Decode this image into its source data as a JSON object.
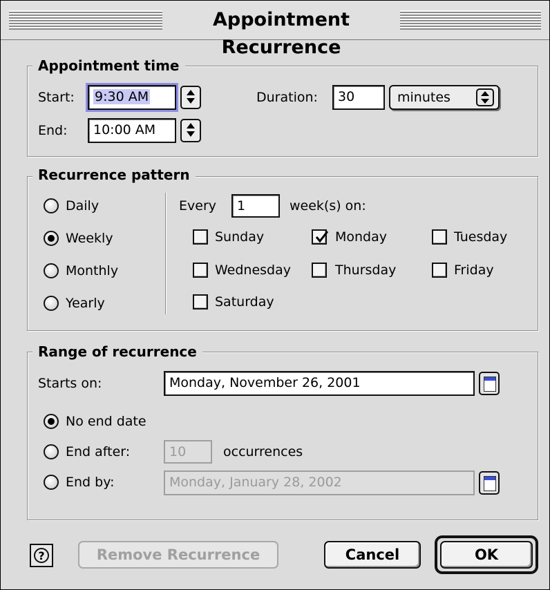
{
  "window": {
    "title": "Appointment Recurrence"
  },
  "appointment_time": {
    "group_label": "Appointment time",
    "start_label": "Start:",
    "start_value": "9:30 AM",
    "end_label": "End:",
    "end_value": "10:00 AM",
    "duration_label": "Duration:",
    "duration_value": "30",
    "duration_unit": "minutes"
  },
  "recurrence_pattern": {
    "group_label": "Recurrence pattern",
    "frequencies": [
      {
        "label": "Daily",
        "selected": false
      },
      {
        "label": "Weekly",
        "selected": true
      },
      {
        "label": "Monthly",
        "selected": false
      },
      {
        "label": "Yearly",
        "selected": false
      }
    ],
    "every_label": "Every",
    "every_value": "1",
    "weeks_on_label": "week(s) on:",
    "days": [
      {
        "label": "Sunday",
        "checked": false
      },
      {
        "label": "Monday",
        "checked": true
      },
      {
        "label": "Tuesday",
        "checked": false
      },
      {
        "label": "Wednesday",
        "checked": false
      },
      {
        "label": "Thursday",
        "checked": false
      },
      {
        "label": "Friday",
        "checked": false
      },
      {
        "label": "Saturday",
        "checked": false
      }
    ]
  },
  "range": {
    "group_label": "Range of recurrence",
    "starts_on_label": "Starts on:",
    "starts_on_value": "Monday, November 26, 2001",
    "no_end_label": "No end date",
    "end_after_label": "End after:",
    "end_after_value": "10",
    "occurrences_label": "occurrences",
    "end_by_label": "End by:",
    "end_by_value": "Monday, January 28, 2002",
    "selected_option": "No end date"
  },
  "buttons": {
    "help_label": "?",
    "remove_label": "Remove Recurrence",
    "cancel_label": "Cancel",
    "ok_label": "OK"
  },
  "icons": [
    "stepper-icon",
    "popup-arrows-icon",
    "calendar-icon",
    "help-icon",
    "checkmark-icon"
  ],
  "colors": {
    "window_bg": "#dcdcdc",
    "selection": "#c9c9f6",
    "focus_ring": "#8e8ee6",
    "calendar_accent": "#3b4fd4"
  }
}
